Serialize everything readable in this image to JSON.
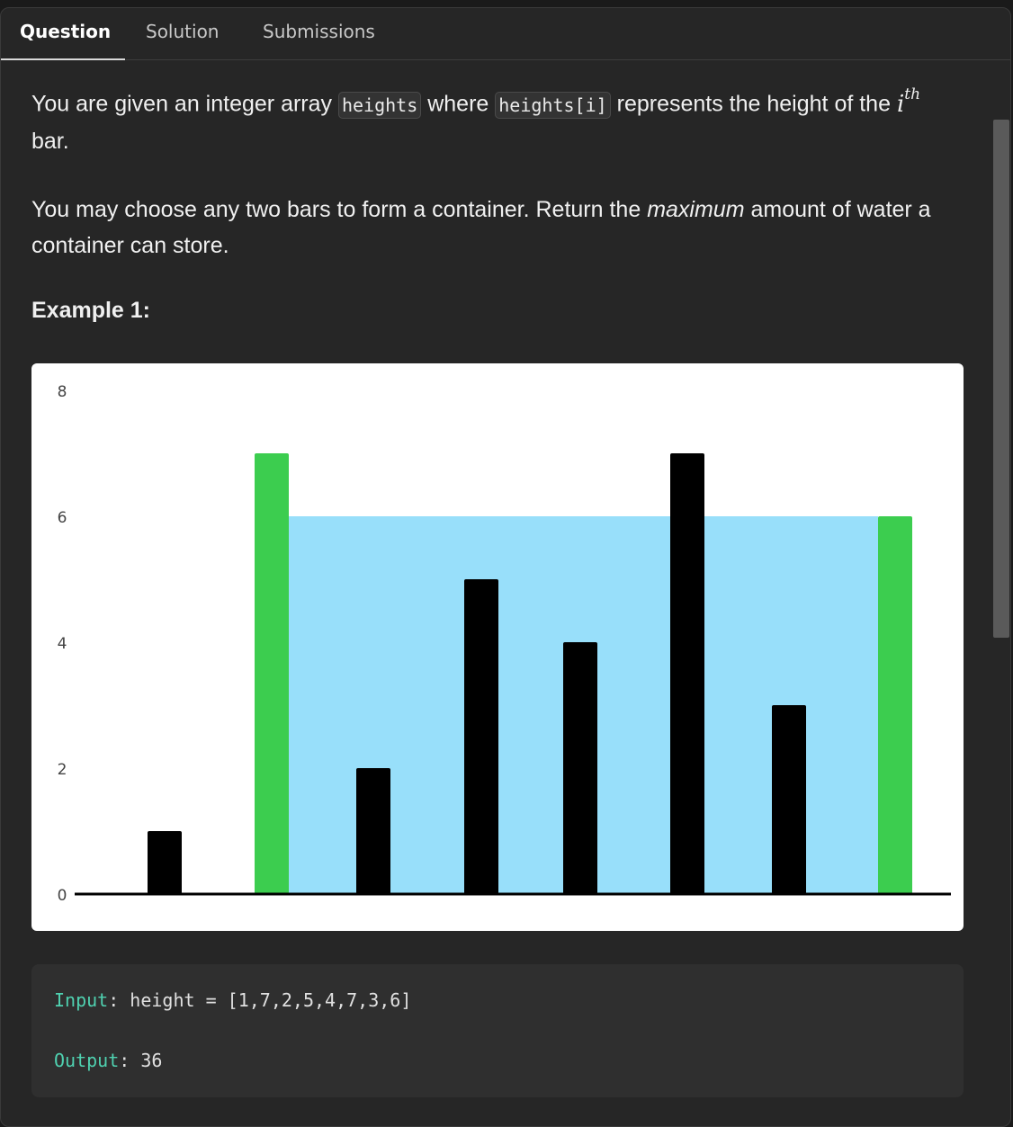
{
  "tabs": [
    {
      "label": "Question",
      "active": true
    },
    {
      "label": "Solution",
      "active": false
    },
    {
      "label": "Submissions",
      "active": false
    }
  ],
  "question": {
    "p1_a": "You are given an integer array ",
    "code1": "heights",
    "p1_b": " where ",
    "code2": "heights[i]",
    "p1_c": " represents the height of the ",
    "math_base": "i",
    "math_sup": "th",
    "p1_d": "bar.",
    "p2_a": "You may choose any two bars to form a container. Return the ",
    "p2_em": "maximum",
    "p2_b": " amount of water a container can store."
  },
  "example_heading": "Example 1:",
  "chart_data": {
    "type": "bar",
    "values": [
      1,
      7,
      2,
      5,
      4,
      7,
      3,
      6
    ],
    "ylim": [
      0,
      8
    ],
    "yticks": [
      "0",
      "2",
      "4",
      "6",
      "8"
    ],
    "highlight_indices": [
      1,
      7
    ],
    "water_level": 6,
    "water_range": [
      1,
      7
    ],
    "colors": {
      "bar": "#000000",
      "highlight": "#3ccd4f",
      "water": "#98dffa",
      "axis": "#000000",
      "tick_text": "#444444"
    }
  },
  "example": {
    "input_key": "Input",
    "input_value": " height = [1,7,2,5,4,7,3,6]",
    "output_key": "Output",
    "output_value": " 36"
  },
  "colors": {
    "panel_bg": "#262626",
    "text": "#f0f0f0",
    "accent_key": "#4fd1b0"
  }
}
